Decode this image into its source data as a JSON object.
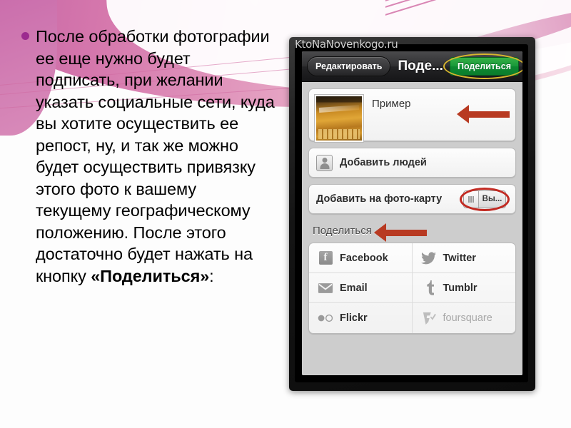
{
  "slide": {
    "bullet_text_plain": "После обработки фотографии ее еще нужно будет подписать, при желании указать социальные сети, куда вы хотите осуществить ее репост, ну, и так же можно будет осуществить привязку этого фото к вашему текущему географическому положению. После этого достаточно будет нажать на кнопку ",
    "bullet_text_bold": "«Поделиться»",
    "bullet_text_tail": ":",
    "accent_pink": "#c767a9",
    "bullet_color": "#9c2a8f"
  },
  "phone": {
    "watermark": "KtoNaNovenkogo.ru",
    "nav": {
      "edit_label": "Редактировать",
      "title": "Поде...",
      "share_label": "Поделиться",
      "share_color": "#17983a",
      "share_highlight_color": "#d8b72e"
    },
    "caption_row": {
      "name": "caption-row",
      "text": "Пример",
      "thumbnail_alt": "photo-thumbnail"
    },
    "rows": [
      {
        "icon": "person-icon",
        "label": "Добавить людей"
      }
    ],
    "map_row": {
      "label": "Добавить на фото-карту",
      "toggle_value": "Вы...",
      "highlight_color": "#c22a22"
    },
    "share_section": {
      "title": "Поделиться"
    },
    "social": [
      {
        "label": "Facebook",
        "icon": "facebook-icon",
        "dim": false
      },
      {
        "label": "Twitter",
        "icon": "twitter-icon",
        "dim": false
      },
      {
        "label": "Email",
        "icon": "email-icon",
        "dim": false
      },
      {
        "label": "Tumblr",
        "icon": "tumblr-icon",
        "dim": false
      },
      {
        "label": "Flickr",
        "icon": "flickr-icon",
        "dim": false
      },
      {
        "label": "foursquare",
        "icon": "foursquare-icon",
        "dim": true
      }
    ],
    "annotations": {
      "arrow_color": "#b83a22",
      "arrow_caption": "arrow-pointing-to-caption",
      "arrow_share": "arrow-pointing-to-share-section"
    }
  }
}
